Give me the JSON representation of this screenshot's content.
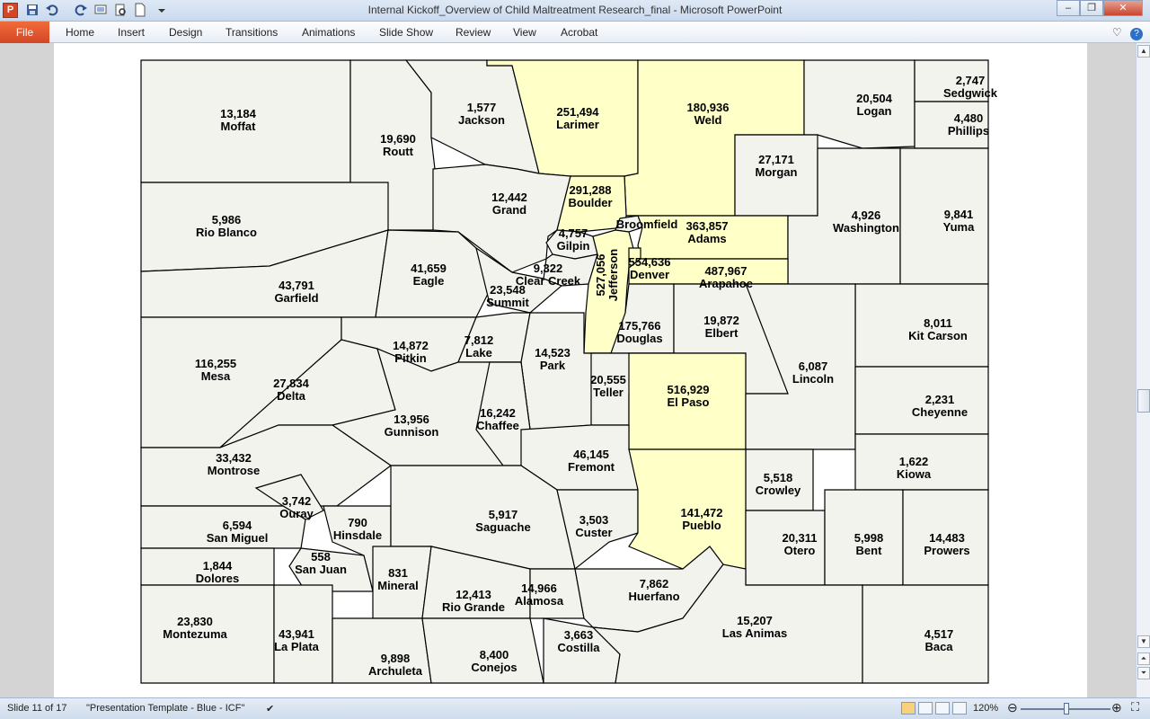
{
  "window": {
    "title": "Internal Kickoff_Overview of Child Maltreatment Research_final  -  Microsoft PowerPoint",
    "app_icon_letter": "P",
    "minimize": "–",
    "restore": "❐",
    "close": "✕"
  },
  "ribbon": {
    "file_label": "File",
    "tabs": [
      "Home",
      "Insert",
      "Design",
      "Transitions",
      "Animations",
      "Slide Show",
      "Review",
      "View",
      "Acrobat"
    ]
  },
  "colors": {
    "highlight": "#ffffc8",
    "county": "#f3f3ee",
    "border": "#000000"
  },
  "map": {
    "counties": [
      {
        "id": "moffat",
        "name": "Moffat",
        "value": "13,184"
      },
      {
        "id": "routt",
        "name": "Routt",
        "value": "19,690"
      },
      {
        "id": "jackson",
        "name": "Jackson",
        "value": "1,577"
      },
      {
        "id": "larimer",
        "name": "Larimer",
        "value": "251,494",
        "highlight": true
      },
      {
        "id": "weld",
        "name": "Weld",
        "value": "180,936",
        "highlight": true
      },
      {
        "id": "logan",
        "name": "Logan",
        "value": "20,504"
      },
      {
        "id": "sedgwick",
        "name": "Sedgwick",
        "value": "2,747"
      },
      {
        "id": "phillips",
        "name": "Phillips",
        "value": "4,480"
      },
      {
        "id": "morgan",
        "name": "Morgan",
        "value": "27,171"
      },
      {
        "id": "rioblanco",
        "name": "Rio Blanco",
        "value": "5,986"
      },
      {
        "id": "grand",
        "name": "Grand",
        "value": "12,442"
      },
      {
        "id": "boulder",
        "name": "Boulder",
        "value": "291,288",
        "highlight": true
      },
      {
        "id": "broomfield",
        "name": "Broomfield",
        "value": ""
      },
      {
        "id": "adams",
        "name": "Adams",
        "value": "363,857",
        "highlight": true
      },
      {
        "id": "washington",
        "name": "Washington",
        "value": "4,926"
      },
      {
        "id": "yuma",
        "name": "Yuma",
        "value": "9,841"
      },
      {
        "id": "gilpin",
        "name": "Gilpin",
        "value": "4,757"
      },
      {
        "id": "garfield",
        "name": "Garfield",
        "value": "43,791"
      },
      {
        "id": "eagle",
        "name": "Eagle",
        "value": "41,659"
      },
      {
        "id": "clearcreek",
        "name": "Clear Creek",
        "value": "9,322"
      },
      {
        "id": "jefferson",
        "name": "Jefferson",
        "value": "527,056",
        "highlight": true
      },
      {
        "id": "denver",
        "name": "Denver",
        "value": "554,636",
        "highlight": true
      },
      {
        "id": "arapahoe",
        "name": "Arapahoe",
        "value": "487,967",
        "highlight": true
      },
      {
        "id": "summit",
        "name": "Summit",
        "value": "23,548"
      },
      {
        "id": "mesa",
        "name": "Mesa",
        "value": "116,255"
      },
      {
        "id": "pitkin",
        "name": "Pitkin",
        "value": "14,872"
      },
      {
        "id": "lake",
        "name": "Lake",
        "value": "7,812"
      },
      {
        "id": "park",
        "name": "Park",
        "value": "14,523"
      },
      {
        "id": "douglas",
        "name": "Douglas",
        "value": "175,766"
      },
      {
        "id": "elbert",
        "name": "Elbert",
        "value": "19,872"
      },
      {
        "id": "kitcarson",
        "name": "Kit Carson",
        "value": "8,011"
      },
      {
        "id": "delta",
        "name": "Delta",
        "value": "27,834"
      },
      {
        "id": "teller",
        "name": "Teller",
        "value": "20,555"
      },
      {
        "id": "elpaso",
        "name": "El Paso",
        "value": "516,929",
        "highlight": true
      },
      {
        "id": "lincoln",
        "name": "Lincoln",
        "value": "6,087"
      },
      {
        "id": "cheyenne",
        "name": "Cheyenne",
        "value": "2,231"
      },
      {
        "id": "gunnison",
        "name": "Gunnison",
        "value": "13,956"
      },
      {
        "id": "chaffee",
        "name": "Chaffee",
        "value": "16,242"
      },
      {
        "id": "montrose",
        "name": "Montrose",
        "value": "33,432"
      },
      {
        "id": "fremont",
        "name": "Fremont",
        "value": "46,145"
      },
      {
        "id": "kiowa",
        "name": "Kiowa",
        "value": "1,622"
      },
      {
        "id": "ouray",
        "name": "Ouray",
        "value": "3,742"
      },
      {
        "id": "crowley",
        "name": "Crowley",
        "value": "5,518"
      },
      {
        "id": "sanmiguel",
        "name": "San Miguel",
        "value": "6,594"
      },
      {
        "id": "hinsdale",
        "name": "Hinsdale",
        "value": "790"
      },
      {
        "id": "saguache",
        "name": "Saguache",
        "value": "5,917"
      },
      {
        "id": "custer",
        "name": "Custer",
        "value": "3,503"
      },
      {
        "id": "pueblo",
        "name": "Pueblo",
        "value": "141,472",
        "highlight": true
      },
      {
        "id": "otero",
        "name": "Otero",
        "value": "20,311"
      },
      {
        "id": "bent",
        "name": "Bent",
        "value": "5,998"
      },
      {
        "id": "prowers",
        "name": "Prowers",
        "value": "14,483"
      },
      {
        "id": "dolores",
        "name": "Dolores",
        "value": "1,844"
      },
      {
        "id": "sanjuan",
        "name": "San Juan",
        "value": "558"
      },
      {
        "id": "mineral",
        "name": "Mineral",
        "value": "831"
      },
      {
        "id": "riogrande",
        "name": "Rio Grande",
        "value": "12,413"
      },
      {
        "id": "alamosa",
        "name": "Alamosa",
        "value": "14,966"
      },
      {
        "id": "huerfano",
        "name": "Huerfano",
        "value": "7,862"
      },
      {
        "id": "montezuma",
        "name": "Montezuma",
        "value": "23,830"
      },
      {
        "id": "laplata",
        "name": "La Plata",
        "value": "43,941"
      },
      {
        "id": "archuleta",
        "name": "Archuleta",
        "value": "9,898"
      },
      {
        "id": "conejos",
        "name": "Conejos",
        "value": "8,400"
      },
      {
        "id": "costilla",
        "name": "Costilla",
        "value": "3,663"
      },
      {
        "id": "lasanimas",
        "name": "Las Animas",
        "value": "15,207"
      },
      {
        "id": "baca",
        "name": "Baca",
        "value": "4,517"
      }
    ]
  },
  "status": {
    "slide_info": "Slide 11 of 17",
    "theme": "\"Presentation Template - Blue - ICF\"",
    "zoom": "120%"
  }
}
